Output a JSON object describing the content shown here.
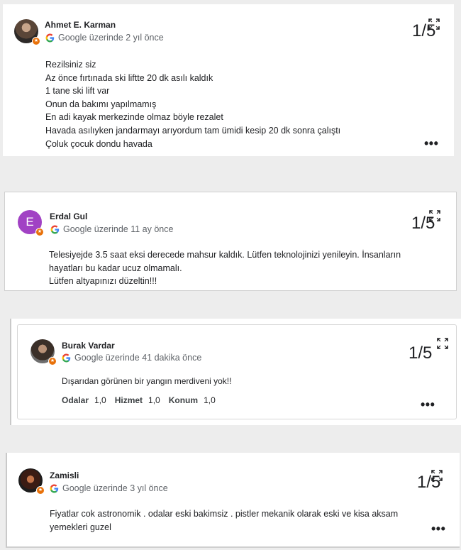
{
  "reviews": [
    {
      "author": "Ahmet E. Karman",
      "meta": "Google üzerinde 2 yıl önce",
      "rating": "1/5",
      "lines": [
        "Rezilsiniz siz",
        "Az önce fırtınada ski liftte 20 dk asılı kaldık",
        "1 tane ski lift var",
        "Onun da bakımı yapılmamış",
        "En adi kayak merkezinde olmaz böyle rezalet",
        "Havada asılıyken jandarmayı arıyordum tam ümidi kesip 20 dk sonra çalıştı",
        "Çoluk çocuk dondu havada"
      ],
      "more": "•••"
    },
    {
      "author": "Erdal Gul",
      "avatar_letter": "E",
      "meta": "Google üzerinde 11 ay önce",
      "rating": "1/5",
      "lines": [
        "Telesiyejde 3.5 saat eksi derecede mahsur kaldık. Lütfen teknolojinizi yenileyin. İnsanların",
        "hayatları bu kadar ucuz olmamalı.",
        "Lütfen altyapınızı düzeltin!!!"
      ]
    },
    {
      "author": "Burak Vardar",
      "meta": "Google üzerinde 41 dakika önce",
      "rating": "1/5",
      "lines": [
        "Dışarıdan görünen bir yangın merdiveni yok!!"
      ],
      "aspects": [
        {
          "label": "Odalar",
          "value": "1,0"
        },
        {
          "label": "Hizmet",
          "value": "1,0"
        },
        {
          "label": "Konum",
          "value": "1,0"
        }
      ],
      "more": "•••"
    },
    {
      "author": "Zamisli",
      "meta": "Google üzerinde 3 yıl önce",
      "rating": "1/5",
      "lines": [
        "Fiyatlar cok astronomik . odalar eski bakimsiz . pistler mekanik olarak eski ve kisa aksam",
        "yemekleri guzel"
      ],
      "more": "•••"
    }
  ],
  "colors": {
    "avatar_purple": "#a142c4",
    "badge_orange": "#e8710a",
    "meta_gray": "#5f6368"
  },
  "icons": {
    "google": "google-g-icon",
    "expand": "expand-icon",
    "more": "more-options-icon",
    "badge": "local-guide-badge-icon"
  }
}
